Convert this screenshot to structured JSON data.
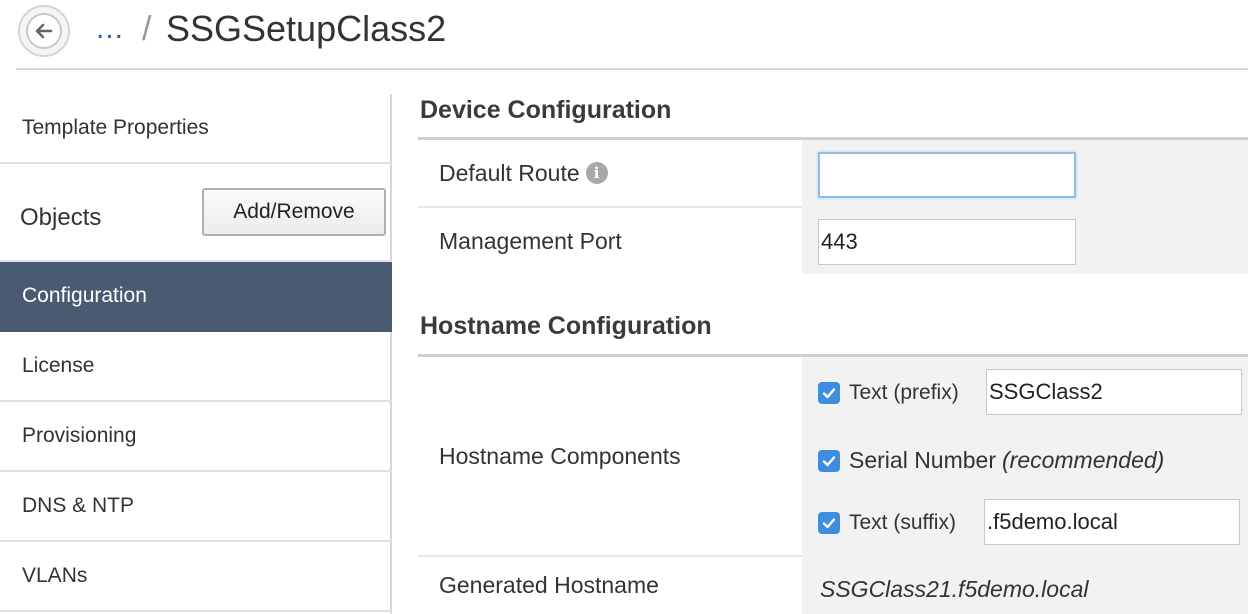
{
  "header": {
    "breadcrumb_ellipsis": "...",
    "breadcrumb_separator": "/",
    "title": "SSGSetupClass2"
  },
  "sidebar": {
    "template_properties": "Template Properties",
    "objects_label": "Objects",
    "add_remove_button": "Add/Remove",
    "items": [
      {
        "label": "Configuration",
        "active": true
      },
      {
        "label": "License",
        "active": false
      },
      {
        "label": "Provisioning",
        "active": false
      },
      {
        "label": "DNS & NTP",
        "active": false
      },
      {
        "label": "VLANs",
        "active": false
      }
    ]
  },
  "device_config": {
    "title": "Device Configuration",
    "default_route_label": "Default Route",
    "default_route_value": "",
    "management_port_label": "Management Port",
    "management_port_value": "443"
  },
  "hostname_config": {
    "title": "Hostname Configuration",
    "components_label": "Hostname Components",
    "prefix_label": "Text (prefix)",
    "prefix_value": "SSGClass2",
    "serial_label": "Serial Number",
    "serial_note": "(recommended)",
    "suffix_label": "Text (suffix)",
    "suffix_value": ".f5demo.local",
    "generated_label": "Generated Hostname",
    "generated_value": "SSGClass21.f5demo.local"
  },
  "colors": {
    "accent": "#3d8de0",
    "active_nav": "#4a5a70",
    "link": "#2a5db0"
  }
}
